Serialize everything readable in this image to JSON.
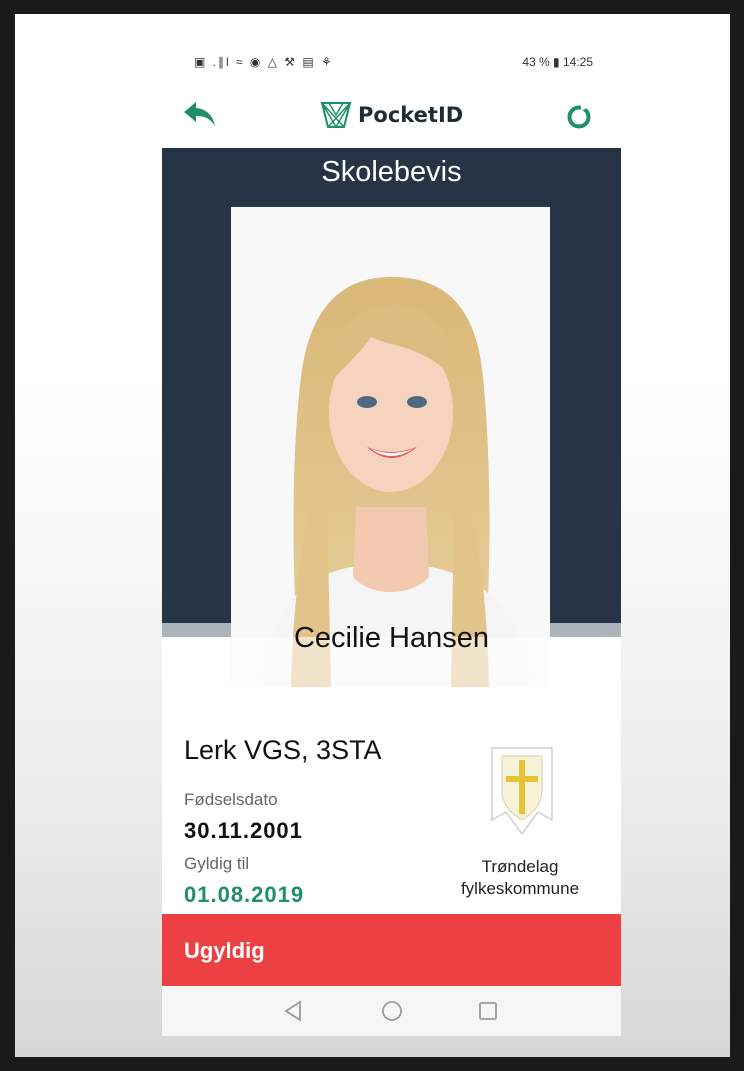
{
  "status_bar": {
    "left_icons": "▣ .∥l ≈ ◉ △ ⚒ ▤ ⚘",
    "battery": "43 %",
    "time": "14:25"
  },
  "app_bar": {
    "brand": "PocketID",
    "back_icon": "back-arrow-icon",
    "refresh_icon": "refresh-icon"
  },
  "card": {
    "title": "Skolebevis",
    "name": "Cecilie Hansen",
    "school": "Lerk VGS, 3STA",
    "birth_label": "Fødselsdato",
    "birth_value": "30.11.2001",
    "valid_label": "Gyldig til",
    "valid_value": "01.08.2019",
    "county_line1": "Trøndelag",
    "county_line2": "fylkeskommune",
    "status": "Ugyldig"
  },
  "colors": {
    "card_header": "#263445",
    "accent_green": "#1e8f6a",
    "invalid_red": "#ec4042"
  }
}
